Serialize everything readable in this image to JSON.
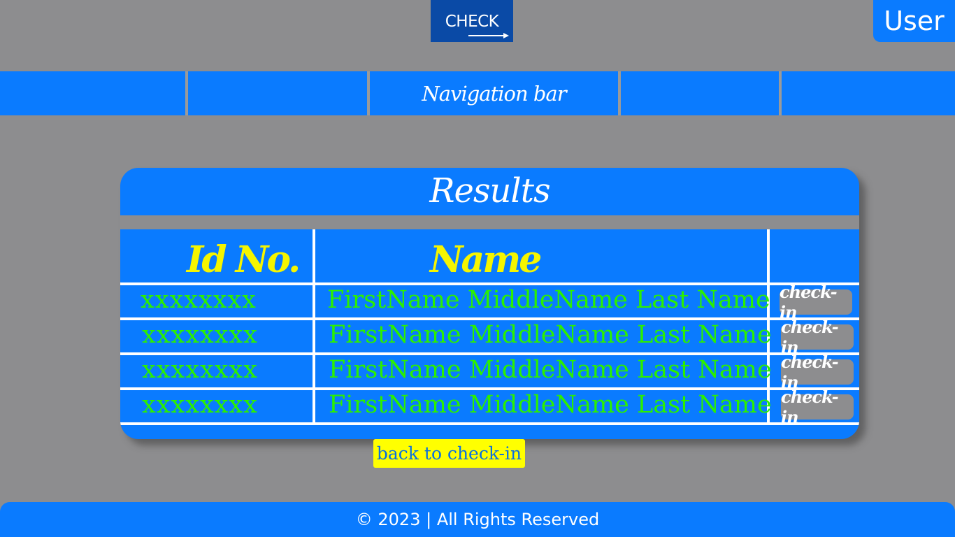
{
  "header": {
    "logo_text": "CHECK",
    "user_label": "User"
  },
  "nav": {
    "items": [
      "",
      "",
      "Navigation bar",
      "",
      ""
    ]
  },
  "results": {
    "title": "Results",
    "columns": [
      "Id No.",
      "Name",
      ""
    ],
    "rows": [
      {
        "id": "xxxxxxxx",
        "name": "FirstName MiddleName Last Name",
        "action": "check-in"
      },
      {
        "id": "xxxxxxxx",
        "name": "FirstName MiddleName Last Name",
        "action": "check-in"
      },
      {
        "id": "xxxxxxxx",
        "name": "FirstName MiddleName Last Name",
        "action": "check-in"
      },
      {
        "id": "xxxxxxxx",
        "name": "FirstName MiddleName Last Name",
        "action": "check-in"
      }
    ]
  },
  "back_button": "back to check-in",
  "footer": {
    "text": "© 2023 | All Rights Reserved"
  },
  "colors": {
    "background": "#8d8d8f",
    "primary_blue": "#0a7bff",
    "logo_blue": "#0a4aa6",
    "header_text": "#f5f500",
    "cell_text": "#2cf000",
    "button_yellow": "#ffff00"
  }
}
